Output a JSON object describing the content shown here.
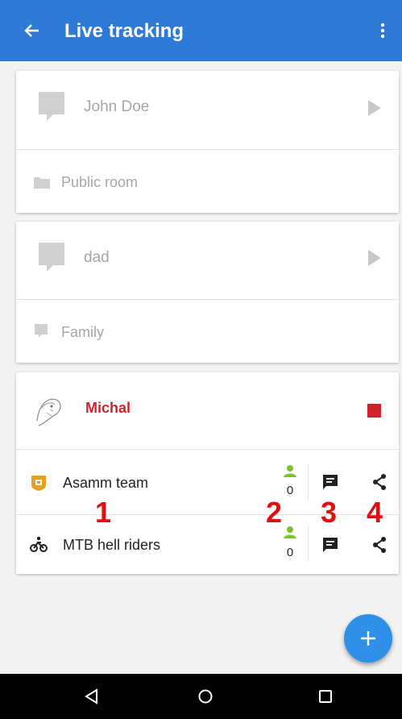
{
  "app_bar": {
    "title": "Live tracking"
  },
  "cards": [
    {
      "name": "John Doe",
      "room": "Public room"
    },
    {
      "name": "dad",
      "room": "Family"
    },
    {
      "name": "Michal",
      "groups": [
        {
          "name": "Asamm team",
          "count": "0"
        },
        {
          "name": "MTB hell riders",
          "count": "0"
        }
      ]
    }
  ],
  "annotations": [
    "1",
    "2",
    "3",
    "4"
  ],
  "colors": {
    "app_bar": "#2f7ad6",
    "stop": "#d0222a",
    "member": "#7cc428",
    "annotation": "#e10f12",
    "fab": "#2f90e8"
  }
}
